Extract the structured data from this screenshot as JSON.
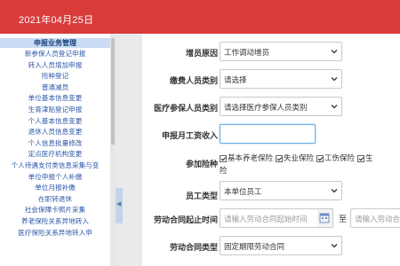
{
  "header": {
    "date": "2021年04月25日",
    "bg_color": "#d93b3b"
  },
  "sidebar": {
    "heading": "申报业务管理",
    "items": [
      "新参保人员登记申报",
      "转入人员增加申报",
      "险种登记",
      "普通减员",
      "单位基本信息变更",
      "生育津贴登记申报",
      "个人基本信息变更",
      "退休人员信息变更",
      "个人信息批量修改",
      "定点医疗机构变更",
      "个人待遇支付类信息采集与变",
      "单位申报个人补缴",
      "单位月报补缴",
      "在职转退休",
      "社会保障卡照片采集",
      "养老保险关系异地转入",
      "医疗保险关系异地转入申"
    ]
  },
  "form": {
    "increase_reason": {
      "label": "增员原因",
      "value": "工作调动增员"
    },
    "payer_category": {
      "label": "缴费人员类别",
      "value": "请选择"
    },
    "medical_category": {
      "label": "医疗参保人员类别",
      "value": "请选择医疗参保人员类别"
    },
    "monthly_wage": {
      "label": "申报月工资收入",
      "value": ""
    },
    "insurance_types": {
      "label": "参加险种",
      "options": [
        {
          "label": "基本养老保险",
          "checked": true
        },
        {
          "label": "失业保险",
          "checked": true
        },
        {
          "label": "工伤保险",
          "checked": true
        },
        {
          "label": "生",
          "checked": true
        }
      ],
      "wrap_text": "险"
    },
    "employee_type": {
      "label": "员工类型",
      "value": "本单位员工"
    },
    "contract_period": {
      "label": "劳动合同起止时间",
      "start_placeholder": "请输入劳动合同起始时间",
      "separator": "至",
      "end_placeholder": "请输入劳动合"
    },
    "contract_type": {
      "label": "劳动合同类型",
      "value": "固定期限劳动合同"
    }
  }
}
